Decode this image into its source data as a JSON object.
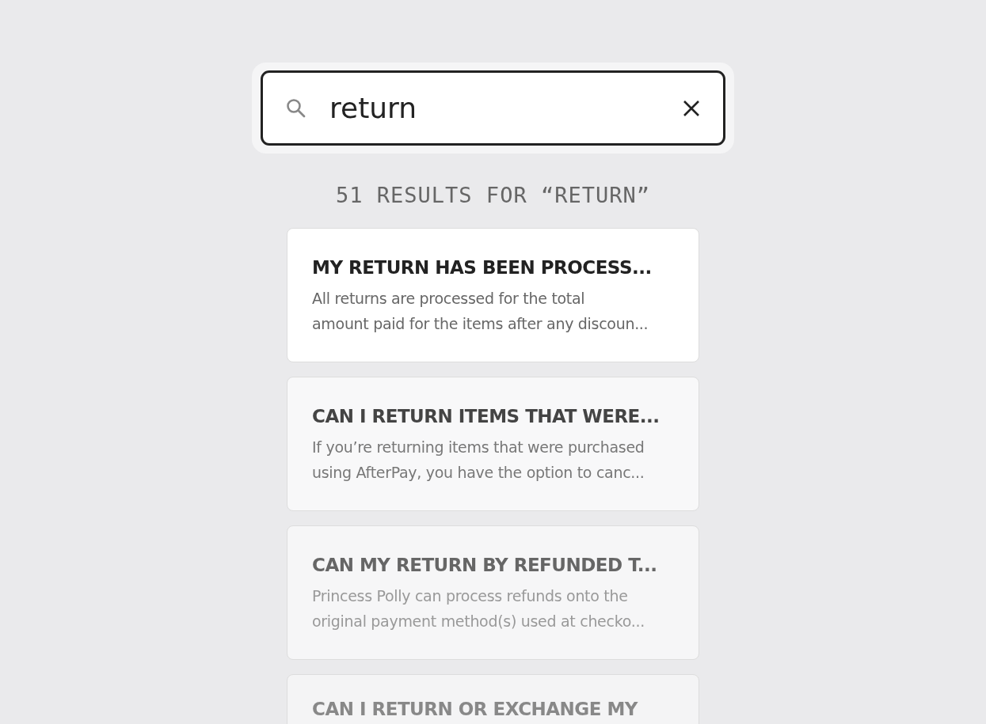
{
  "search": {
    "value": "return"
  },
  "results_summary": "51 RESULTS FOR “RETURN”",
  "results": [
    {
      "title": "MY RETURN HAS BEEN PROCESS...",
      "lines": [
        "All returns are processed for the total",
        "amount paid for the items after any discoun..."
      ]
    },
    {
      "title": "CAN I RETURN ITEMS THAT WERE...",
      "lines": [
        "If you’re returning items that were purchased",
        "using AfterPay, you have the option to canc..."
      ]
    },
    {
      "title": "CAN MY RETURN BY REFUNDED T...",
      "lines": [
        "Princess Polly can process refunds onto the",
        "original payment method(s) used at checko..."
      ]
    },
    {
      "title": "CAN I RETURN OR EXCHANGE MY"
    }
  ]
}
